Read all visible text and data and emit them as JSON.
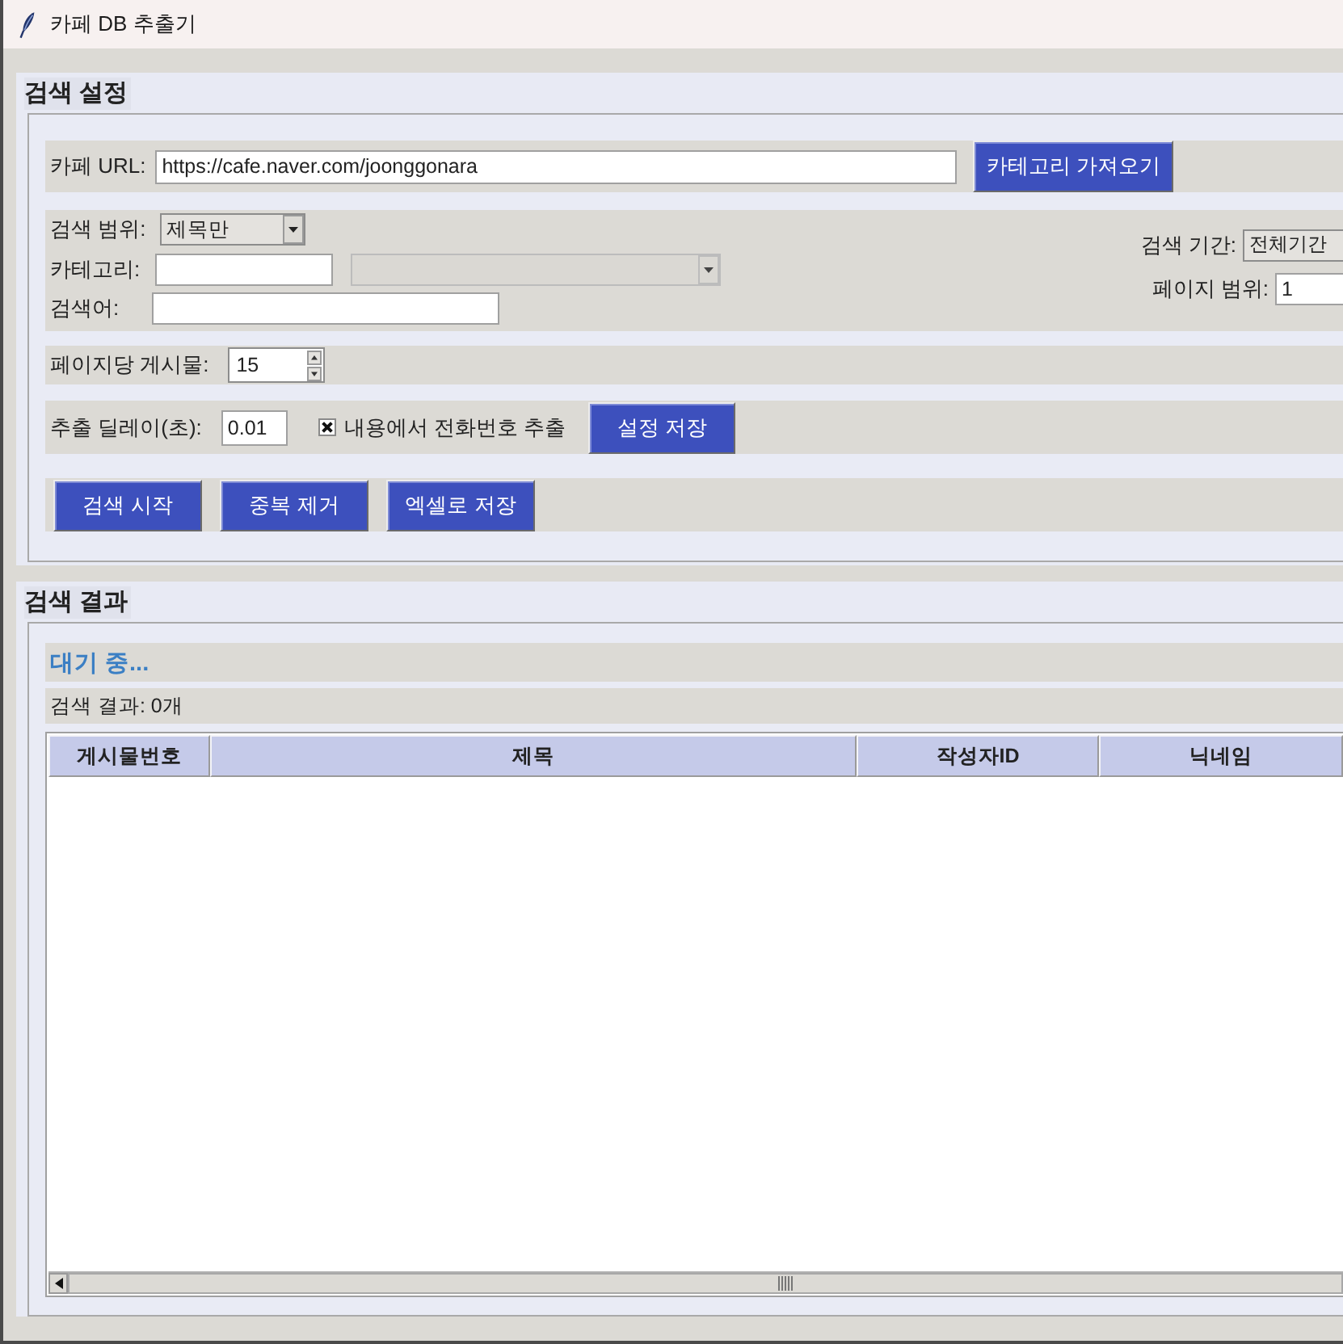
{
  "window": {
    "title": "카페 DB 추출기"
  },
  "search_settings": {
    "title": "검색 설정",
    "cafe_url": {
      "label": "카페 URL:",
      "value": "https://cafe.naver.com/joonggonara"
    },
    "fetch_categories_button": "카테고리 가져오기",
    "search_scope": {
      "label": "검색 범위:",
      "value": "제목만"
    },
    "category": {
      "label": "카테고리:",
      "subcategory_dropdown": {
        "disabled": true
      }
    },
    "keyword": {
      "label": "검색어:"
    },
    "search_period": {
      "label": "검색 기간:",
      "value": "전체기간"
    },
    "page_range": {
      "label": "페이지 범위:",
      "value": "1"
    },
    "posts_per_page": {
      "label": "페이지당 게시물:",
      "value": "15"
    },
    "delay": {
      "label": "추출 딜레이(초):",
      "value": "0.01"
    },
    "extract_phone": {
      "label": "내용에서 전화번호 추출",
      "checked": true
    },
    "save_settings_button": "설정 저장",
    "action_buttons": [
      "검색 시작",
      "중복 제거",
      "엑셀로 저장"
    ]
  },
  "search_results": {
    "title": "검색 결과",
    "status": "대기 중...",
    "count": "검색 결과: 0개",
    "table": {
      "columns": [
        "게시물번호",
        "제목",
        "작성자ID",
        "닉네임"
      ]
    }
  }
}
